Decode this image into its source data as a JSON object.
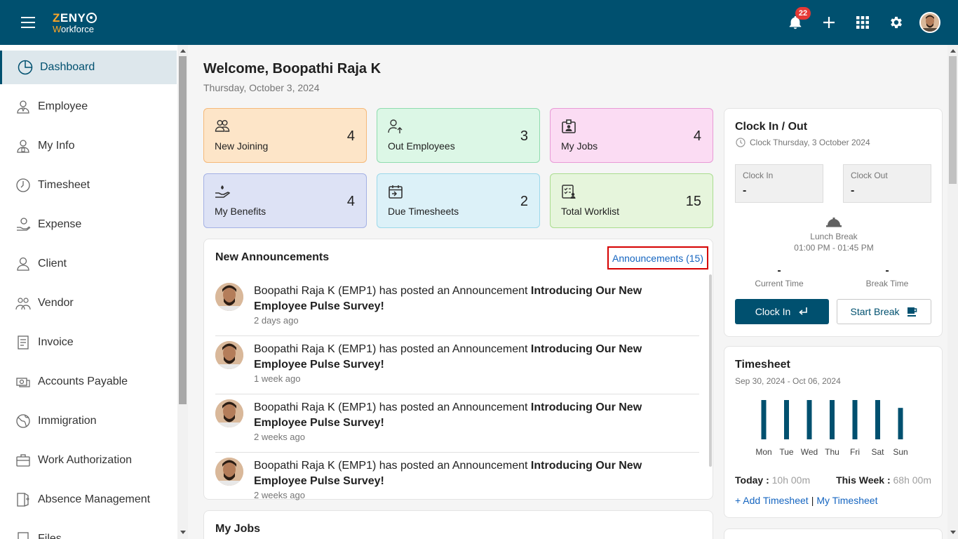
{
  "topbar": {
    "logo_top": "ZENY",
    "logo_z": "Z",
    "logo_rest": "ENY",
    "logo_bottom_w": "W",
    "logo_bottom_rest": "orkforce",
    "notification_count": "22",
    "icons": [
      "menu-icon",
      "bell-icon",
      "plus-icon",
      "apps-grid-icon",
      "gear-icon"
    ],
    "bg_color": "#00506f",
    "accent_color": "#ffa726"
  },
  "sidebar": {
    "items": [
      {
        "label": "Dashboard",
        "icon": "dashboard-icon",
        "active": true
      },
      {
        "label": "Employee",
        "icon": "employee-icon"
      },
      {
        "label": "My Info",
        "icon": "my-info-icon"
      },
      {
        "label": "Timesheet",
        "icon": "clock-icon"
      },
      {
        "label": "Expense",
        "icon": "expense-icon"
      },
      {
        "label": "Client",
        "icon": "client-icon"
      },
      {
        "label": "Vendor",
        "icon": "vendor-icon"
      },
      {
        "label": "Invoice",
        "icon": "invoice-icon"
      },
      {
        "label": "Accounts Payable",
        "icon": "accounts-payable-icon"
      },
      {
        "label": "Immigration",
        "icon": "globe-icon"
      },
      {
        "label": "Work Authorization",
        "icon": "work-authorization-icon"
      },
      {
        "label": "Absence Management",
        "icon": "absence-icon"
      },
      {
        "label": "Files",
        "icon": "files-icon"
      }
    ]
  },
  "main": {
    "welcome": "Welcome, Boopathi Raja K",
    "date": "Thursday, October 3, 2024"
  },
  "stats": [
    {
      "label": "New Joining",
      "value": "4",
      "icon": "group-icon",
      "bg": "#fde5c8",
      "border": "#f5b979"
    },
    {
      "label": "Out Employees",
      "value": "3",
      "icon": "person-out-icon",
      "bg": "#dcf7e6",
      "border": "#8fdcae"
    },
    {
      "label": "My Jobs",
      "value": "4",
      "icon": "badge-icon",
      "bg": "#fbdcf3",
      "border": "#e89ad6"
    },
    {
      "label": "My Benefits",
      "value": "4",
      "icon": "benefits-icon",
      "bg": "#dde2f5",
      "border": "#a4b1e4"
    },
    {
      "label": "Due Timesheets",
      "value": "2",
      "icon": "calendar-icon",
      "bg": "#dcf1f8",
      "border": "#9cd8ea"
    },
    {
      "label": "Total Worklist",
      "value": "15",
      "icon": "worklist-icon",
      "bg": "#e6f5dc",
      "border": "#aadc8f"
    }
  ],
  "announcements": {
    "title": "New Announcements",
    "link": "Announcements (15)",
    "items": [
      {
        "author": "Boopathi Raja K (EMP1) has posted an Announcement ",
        "subject": "Introducing Our New Employee Pulse Survey!",
        "ago": "2 days ago"
      },
      {
        "author": "Boopathi Raja K (EMP1) has posted an Announcement ",
        "subject": "Introducing Our New Employee Pulse Survey!",
        "ago": "1 week ago"
      },
      {
        "author": "Boopathi Raja K (EMP1) has posted an Announcement ",
        "subject": "Introducing Our New Employee Pulse Survey!",
        "ago": "2 weeks ago"
      },
      {
        "author": "Boopathi Raja K (EMP1) has posted an Announcement ",
        "subject": "Introducing Our New Employee Pulse Survey!",
        "ago": "2 weeks ago"
      }
    ]
  },
  "myjobs": {
    "title": "My Jobs"
  },
  "clock": {
    "title": "Clock In / Out",
    "subtitle": "Clock Thursday, 3 October 2024",
    "clock_in_label": "Clock In",
    "clock_in_value": "-",
    "clock_out_label": "Clock Out",
    "clock_out_value": "-",
    "lunch_label": "Lunch Break",
    "lunch_time": "01:00 PM - 01:45 PM",
    "current_time_value": "-",
    "current_time_label": "Current Time",
    "break_time_value": "-",
    "break_time_label": "Break Time",
    "clock_in_button": "Clock In",
    "start_break_button": "Start Break"
  },
  "timesheet": {
    "title": "Timesheet",
    "range": "Sep 30, 2024 - Oct 06, 2024",
    "today_label": "Today :",
    "today_value": "10h 00m",
    "week_label": "This Week :",
    "week_value": "68h 00m",
    "add_link": "+ Add Timesheet",
    "separator": "|",
    "my_link": "My Timesheet"
  },
  "chart_data": {
    "type": "bar",
    "categories": [
      "Mon",
      "Tue",
      "Wed",
      "Thu",
      "Fri",
      "Sat",
      "Sun"
    ],
    "values": [
      10,
      10,
      10,
      10,
      10,
      10,
      8
    ],
    "ylim": [
      0,
      10
    ],
    "color": "#00506f"
  }
}
